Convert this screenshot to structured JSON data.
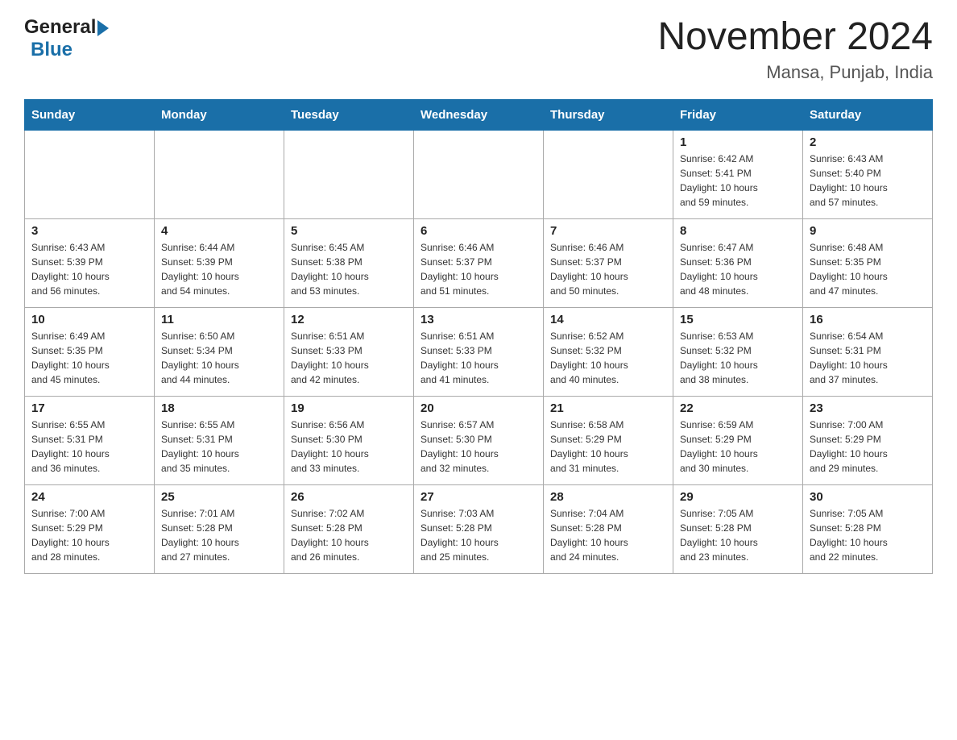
{
  "header": {
    "logo_general": "General",
    "logo_blue": "Blue",
    "month_title": "November 2024",
    "location": "Mansa, Punjab, India"
  },
  "weekdays": [
    "Sunday",
    "Monday",
    "Tuesday",
    "Wednesday",
    "Thursday",
    "Friday",
    "Saturday"
  ],
  "weeks": [
    [
      {
        "day": "",
        "info": ""
      },
      {
        "day": "",
        "info": ""
      },
      {
        "day": "",
        "info": ""
      },
      {
        "day": "",
        "info": ""
      },
      {
        "day": "",
        "info": ""
      },
      {
        "day": "1",
        "info": "Sunrise: 6:42 AM\nSunset: 5:41 PM\nDaylight: 10 hours\nand 59 minutes."
      },
      {
        "day": "2",
        "info": "Sunrise: 6:43 AM\nSunset: 5:40 PM\nDaylight: 10 hours\nand 57 minutes."
      }
    ],
    [
      {
        "day": "3",
        "info": "Sunrise: 6:43 AM\nSunset: 5:39 PM\nDaylight: 10 hours\nand 56 minutes."
      },
      {
        "day": "4",
        "info": "Sunrise: 6:44 AM\nSunset: 5:39 PM\nDaylight: 10 hours\nand 54 minutes."
      },
      {
        "day": "5",
        "info": "Sunrise: 6:45 AM\nSunset: 5:38 PM\nDaylight: 10 hours\nand 53 minutes."
      },
      {
        "day": "6",
        "info": "Sunrise: 6:46 AM\nSunset: 5:37 PM\nDaylight: 10 hours\nand 51 minutes."
      },
      {
        "day": "7",
        "info": "Sunrise: 6:46 AM\nSunset: 5:37 PM\nDaylight: 10 hours\nand 50 minutes."
      },
      {
        "day": "8",
        "info": "Sunrise: 6:47 AM\nSunset: 5:36 PM\nDaylight: 10 hours\nand 48 minutes."
      },
      {
        "day": "9",
        "info": "Sunrise: 6:48 AM\nSunset: 5:35 PM\nDaylight: 10 hours\nand 47 minutes."
      }
    ],
    [
      {
        "day": "10",
        "info": "Sunrise: 6:49 AM\nSunset: 5:35 PM\nDaylight: 10 hours\nand 45 minutes."
      },
      {
        "day": "11",
        "info": "Sunrise: 6:50 AM\nSunset: 5:34 PM\nDaylight: 10 hours\nand 44 minutes."
      },
      {
        "day": "12",
        "info": "Sunrise: 6:51 AM\nSunset: 5:33 PM\nDaylight: 10 hours\nand 42 minutes."
      },
      {
        "day": "13",
        "info": "Sunrise: 6:51 AM\nSunset: 5:33 PM\nDaylight: 10 hours\nand 41 minutes."
      },
      {
        "day": "14",
        "info": "Sunrise: 6:52 AM\nSunset: 5:32 PM\nDaylight: 10 hours\nand 40 minutes."
      },
      {
        "day": "15",
        "info": "Sunrise: 6:53 AM\nSunset: 5:32 PM\nDaylight: 10 hours\nand 38 minutes."
      },
      {
        "day": "16",
        "info": "Sunrise: 6:54 AM\nSunset: 5:31 PM\nDaylight: 10 hours\nand 37 minutes."
      }
    ],
    [
      {
        "day": "17",
        "info": "Sunrise: 6:55 AM\nSunset: 5:31 PM\nDaylight: 10 hours\nand 36 minutes."
      },
      {
        "day": "18",
        "info": "Sunrise: 6:55 AM\nSunset: 5:31 PM\nDaylight: 10 hours\nand 35 minutes."
      },
      {
        "day": "19",
        "info": "Sunrise: 6:56 AM\nSunset: 5:30 PM\nDaylight: 10 hours\nand 33 minutes."
      },
      {
        "day": "20",
        "info": "Sunrise: 6:57 AM\nSunset: 5:30 PM\nDaylight: 10 hours\nand 32 minutes."
      },
      {
        "day": "21",
        "info": "Sunrise: 6:58 AM\nSunset: 5:29 PM\nDaylight: 10 hours\nand 31 minutes."
      },
      {
        "day": "22",
        "info": "Sunrise: 6:59 AM\nSunset: 5:29 PM\nDaylight: 10 hours\nand 30 minutes."
      },
      {
        "day": "23",
        "info": "Sunrise: 7:00 AM\nSunset: 5:29 PM\nDaylight: 10 hours\nand 29 minutes."
      }
    ],
    [
      {
        "day": "24",
        "info": "Sunrise: 7:00 AM\nSunset: 5:29 PM\nDaylight: 10 hours\nand 28 minutes."
      },
      {
        "day": "25",
        "info": "Sunrise: 7:01 AM\nSunset: 5:28 PM\nDaylight: 10 hours\nand 27 minutes."
      },
      {
        "day": "26",
        "info": "Sunrise: 7:02 AM\nSunset: 5:28 PM\nDaylight: 10 hours\nand 26 minutes."
      },
      {
        "day": "27",
        "info": "Sunrise: 7:03 AM\nSunset: 5:28 PM\nDaylight: 10 hours\nand 25 minutes."
      },
      {
        "day": "28",
        "info": "Sunrise: 7:04 AM\nSunset: 5:28 PM\nDaylight: 10 hours\nand 24 minutes."
      },
      {
        "day": "29",
        "info": "Sunrise: 7:05 AM\nSunset: 5:28 PM\nDaylight: 10 hours\nand 23 minutes."
      },
      {
        "day": "30",
        "info": "Sunrise: 7:05 AM\nSunset: 5:28 PM\nDaylight: 10 hours\nand 22 minutes."
      }
    ]
  ]
}
